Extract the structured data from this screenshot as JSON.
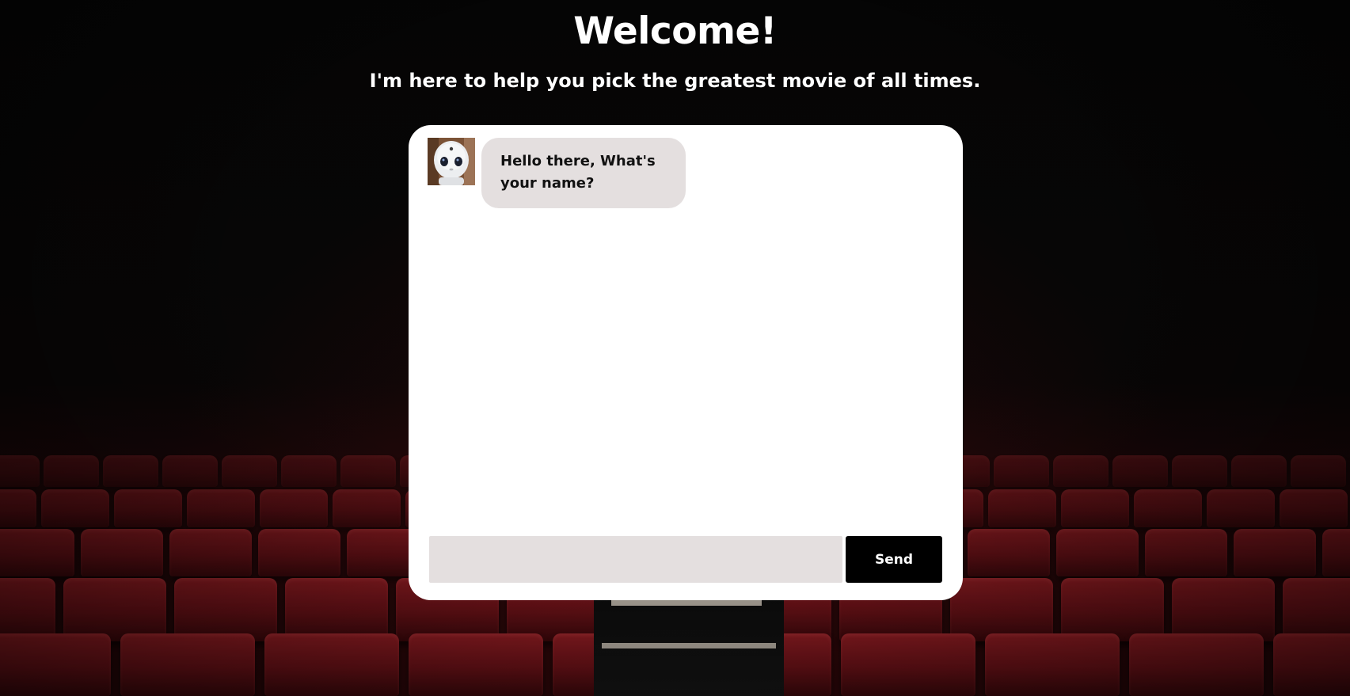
{
  "header": {
    "title": "Welcome!",
    "subtitle": "I'm here to help you pick the greatest movie of all times."
  },
  "chat": {
    "messages": [
      {
        "sender": "bot",
        "avatar_icon": "robot-avatar-icon",
        "text": "Hello there, What's your name?"
      }
    ],
    "input": {
      "value": "",
      "placeholder": ""
    },
    "send_label": "Send"
  },
  "colors": {
    "card_background": "#ffffff",
    "bubble_background": "#e4dfdf",
    "input_background": "#e4dfdf",
    "send_button_background": "#000000",
    "text_on_dark": "#ffffff",
    "seat_red": "#8e1c22"
  }
}
